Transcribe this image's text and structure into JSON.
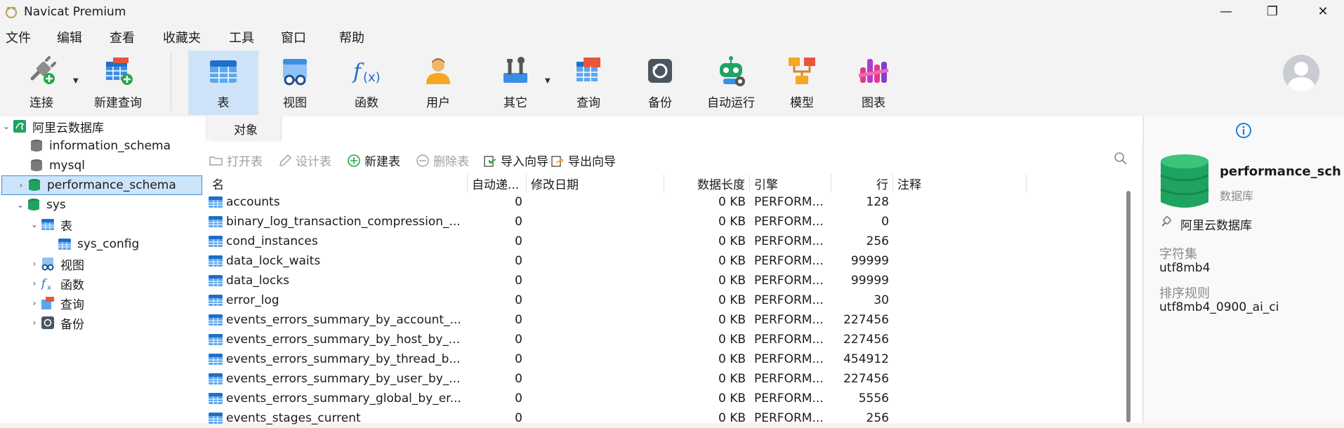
{
  "window": {
    "title": "Navicat Premium",
    "minimize": "—",
    "maximize": "❐",
    "close": "✕"
  },
  "menu": [
    "文件",
    "编辑",
    "查看",
    "收藏夹",
    "工具",
    "窗口",
    "帮助"
  ],
  "toolbar": {
    "connect": "连接",
    "new_query": "新建查询",
    "table": "表",
    "view": "视图",
    "function": "函数",
    "user": "用户",
    "other": "其它",
    "query": "查询",
    "backup": "备份",
    "automation": "自动运行",
    "model": "模型",
    "chart": "图表"
  },
  "tree": {
    "connection": "阿里云数据库",
    "databases": [
      "information_schema",
      "mysql",
      "performance_schema",
      "sys"
    ],
    "sys_children": {
      "tables": "表",
      "table_item": "sys_config",
      "views": "视图",
      "functions": "函数",
      "queries": "查询",
      "backups": "备份"
    }
  },
  "tabs": {
    "objects": "对象"
  },
  "object_toolbar": {
    "open": "打开表",
    "design": "设计表",
    "new": "新建表",
    "delete": "删除表",
    "import": "导入向导",
    "export": "导出向导"
  },
  "table": {
    "columns": [
      "名",
      "自动递...",
      "修改日期",
      "数据长度",
      "引擎",
      "行",
      "注释"
    ],
    "rows": [
      {
        "name": "accounts",
        "auto": "0",
        "modified": "",
        "length": "0 KB",
        "engine": "PERFORM...",
        "rows": "128"
      },
      {
        "name": "binary_log_transaction_compression_...",
        "auto": "0",
        "modified": "",
        "length": "0 KB",
        "engine": "PERFORM...",
        "rows": "0"
      },
      {
        "name": "cond_instances",
        "auto": "0",
        "modified": "",
        "length": "0 KB",
        "engine": "PERFORM...",
        "rows": "256"
      },
      {
        "name": "data_lock_waits",
        "auto": "0",
        "modified": "",
        "length": "0 KB",
        "engine": "PERFORM...",
        "rows": "99999"
      },
      {
        "name": "data_locks",
        "auto": "0",
        "modified": "",
        "length": "0 KB",
        "engine": "PERFORM...",
        "rows": "99999"
      },
      {
        "name": "error_log",
        "auto": "0",
        "modified": "",
        "length": "0 KB",
        "engine": "PERFORM...",
        "rows": "30"
      },
      {
        "name": "events_errors_summary_by_account_...",
        "auto": "0",
        "modified": "",
        "length": "0 KB",
        "engine": "PERFORM...",
        "rows": "227456"
      },
      {
        "name": "events_errors_summary_by_host_by_...",
        "auto": "0",
        "modified": "",
        "length": "0 KB",
        "engine": "PERFORM...",
        "rows": "227456"
      },
      {
        "name": "events_errors_summary_by_thread_b...",
        "auto": "0",
        "modified": "",
        "length": "0 KB",
        "engine": "PERFORM...",
        "rows": "454912"
      },
      {
        "name": "events_errors_summary_by_user_by_...",
        "auto": "0",
        "modified": "",
        "length": "0 KB",
        "engine": "PERFORM...",
        "rows": "227456"
      },
      {
        "name": "events_errors_summary_global_by_er...",
        "auto": "0",
        "modified": "",
        "length": "0 KB",
        "engine": "PERFORM...",
        "rows": "5556"
      },
      {
        "name": "events_stages_current",
        "auto": "0",
        "modified": "",
        "length": "0 KB",
        "engine": "PERFORM...",
        "rows": "256"
      }
    ]
  },
  "info_panel": {
    "name": "performance_sch",
    "type": "数据库",
    "connection": "阿里云数据库",
    "charset_label": "字符集",
    "charset": "utf8mb4",
    "collation_label": "排序规则",
    "collation": "utf8mb4_0900_ai_ci"
  },
  "colors": {
    "accent": "#1a7fe0",
    "selection": "#cde4fa",
    "db_green": "#1fa361"
  }
}
